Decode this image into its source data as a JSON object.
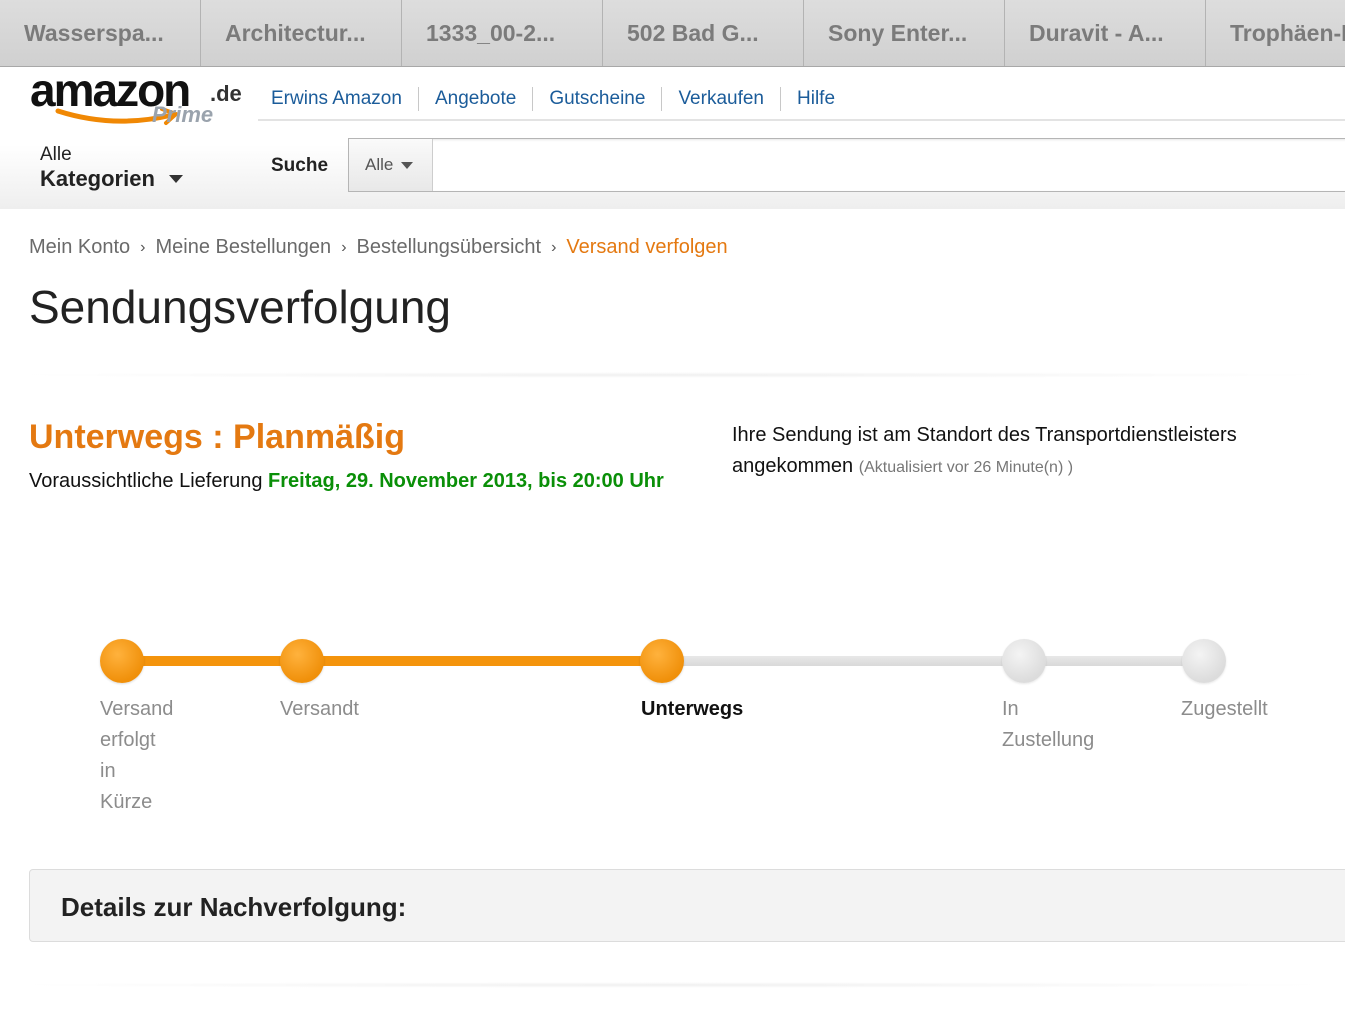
{
  "browser": {
    "tabs": [
      "Wasserspa...",
      "Architectur...",
      "1333_00-2...",
      "502 Bad G...",
      "Sony Enter...",
      "Duravit - A...",
      "Trophäen-I"
    ]
  },
  "header": {
    "logo": {
      "word": "amazon",
      "tld": ".de",
      "sub": "Prime"
    },
    "nav": [
      "Erwins Amazon",
      "Angebote",
      "Gutscheine",
      "Verkaufen",
      "Hilfe"
    ],
    "categories": {
      "small": "Alle",
      "big": "Kategorien"
    },
    "search": {
      "label": "Suche",
      "dropdown": "Alle",
      "value": ""
    }
  },
  "breadcrumb": [
    "Mein Konto",
    "Meine Bestellungen",
    "Bestellungsübersicht",
    "Versand verfolgen"
  ],
  "page_title": "Sendungsverfolgung",
  "status": {
    "title": "Unterwegs : Planmäßig",
    "delivery_prefix": "Voraussichtliche Lieferung",
    "delivery_date": "Freitag, 29. November 2013, bis 20:00 Uhr",
    "message": "Ihre Sendung ist am Standort des Transportdienstleisters angekommen",
    "updated": "(Aktualisiert vor 26 Minute(n) )"
  },
  "tracker": {
    "steps": [
      {
        "lines": [
          "Versand",
          "erfolgt",
          "in",
          "Kürze"
        ],
        "state": "done"
      },
      {
        "lines": [
          "Versandt"
        ],
        "state": "done"
      },
      {
        "lines": [
          "Unterwegs"
        ],
        "state": "active"
      },
      {
        "lines": [
          "In",
          "Zustellung"
        ],
        "state": "pending"
      },
      {
        "lines": [
          "Zugestellt"
        ],
        "state": "pending"
      }
    ]
  },
  "details_heading": "Details zur Nachverfolgung:",
  "colors": {
    "accent": "#e47911",
    "progress": "#f4940c",
    "delivery": "#0a8f08",
    "link": "#1b5c9a"
  }
}
